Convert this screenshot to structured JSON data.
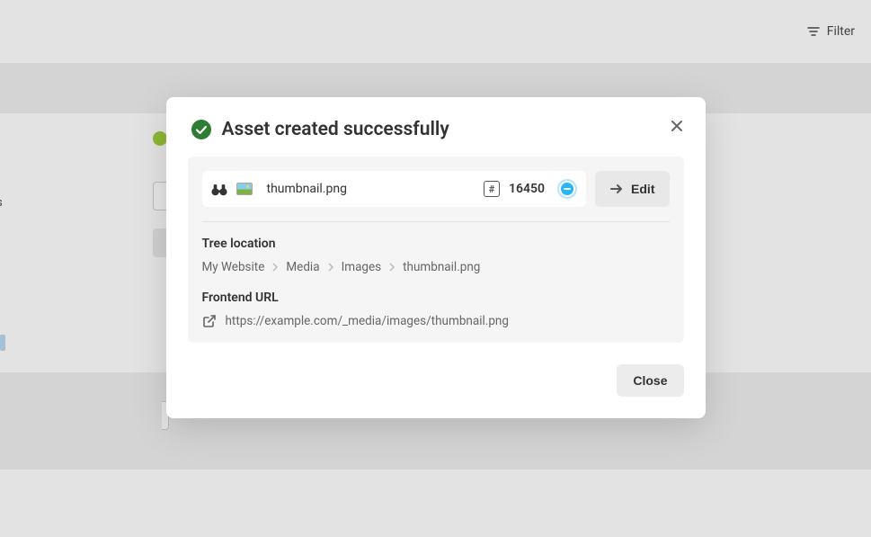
{
  "topbar": {
    "filter_label": "Filter"
  },
  "modal": {
    "title": "Asset created successfully",
    "asset": {
      "filename": "thumbnail.png",
      "id": "16450"
    },
    "edit_label": "Edit",
    "tree_location_label": "Tree location",
    "breadcrumb": [
      "My Website",
      "Media",
      "Images",
      "thumbnail.png"
    ],
    "frontend_url_label": "Frontend URL",
    "frontend_url": "https://example.com/_media/images/thumbnail.png",
    "close_label": "Close"
  },
  "left_truncated_text": "s"
}
